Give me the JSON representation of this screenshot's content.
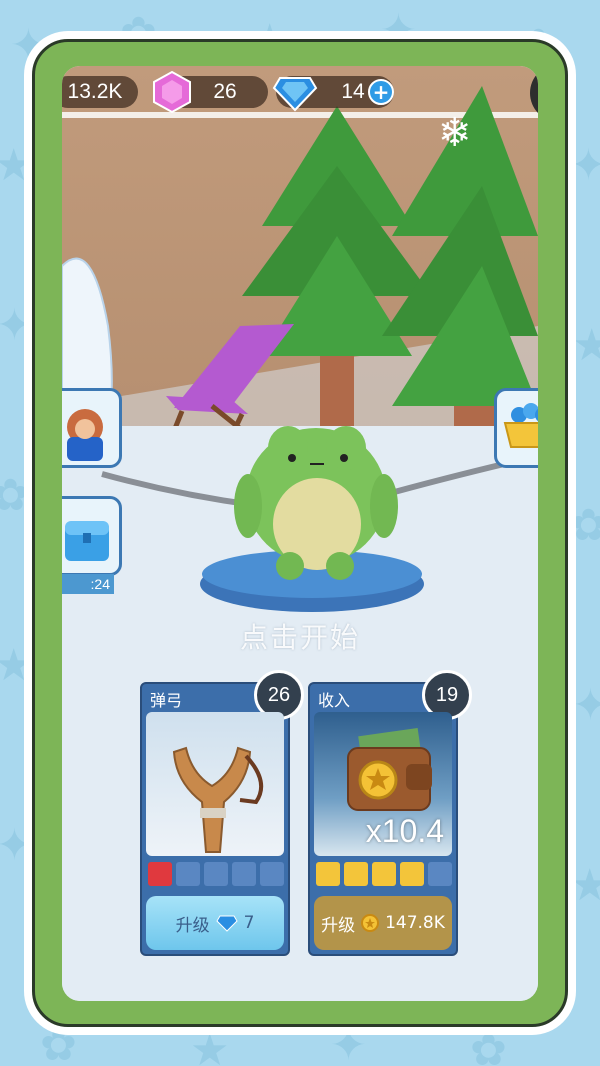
{
  "resources": {
    "coins": "13.2K",
    "pink_gems": "26",
    "blue_diamonds": "14"
  },
  "timer": ":24",
  "tap_to_start": "点击开始",
  "cards": [
    {
      "title": "弹弓",
      "level_badge": "26",
      "filled_pips": 1,
      "total_pips": 5,
      "upgrade_label": "升级",
      "cost": "7",
      "cost_icon": "diamond-icon"
    },
    {
      "title": "收入",
      "level_badge": "19",
      "filled_pips": 4,
      "total_pips": 5,
      "multiplier": "x10.4",
      "upgrade_label": "升级",
      "cost": "147.8K",
      "cost_icon": "coin-icon"
    }
  ],
  "colors": {
    "frame_green": "#7db557",
    "card_blue": "#3c6eaa",
    "pip_red": "#e0393e",
    "pip_yellow": "#f3c53a",
    "pip_empty": "#5a87c2",
    "upgrade_blue": "#7fd0f1",
    "upgrade_brown": "#b3944a"
  }
}
